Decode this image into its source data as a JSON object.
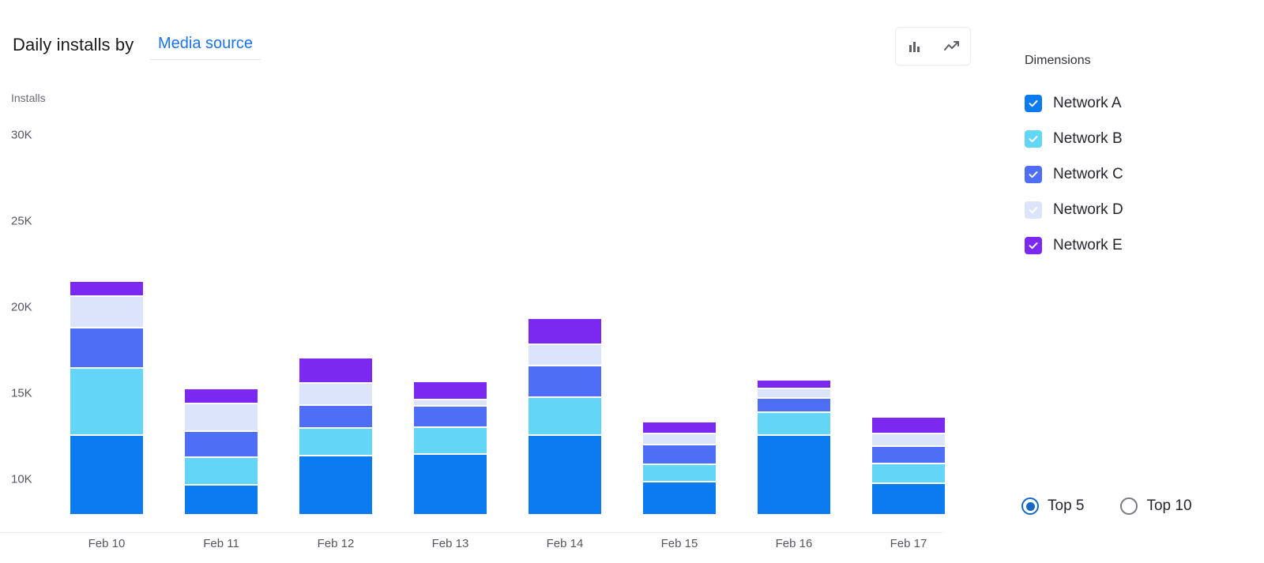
{
  "header": {
    "title": "Daily installs by",
    "dimension_selector": "Media source"
  },
  "toolbar": {
    "bar_chart_icon": "bar-chart-icon",
    "line_chart_icon": "line-chart-icon",
    "selected": "bar"
  },
  "side_panel": {
    "heading": "Dimensions",
    "items": [
      {
        "label": "Network A",
        "color": "#0c7bf0",
        "checked": true
      },
      {
        "label": "Network B",
        "color": "#63d6f7",
        "checked": true
      },
      {
        "label": "Network C",
        "color": "#4d6ef5",
        "checked": true
      },
      {
        "label": "Network D",
        "color": "#dbe4fb",
        "checked": true
      },
      {
        "label": "Network E",
        "color": "#7b28f0",
        "checked": true
      }
    ],
    "top_n": {
      "options": [
        {
          "label": "Top 5",
          "selected": true
        },
        {
          "label": "Top 10",
          "selected": false
        }
      ]
    }
  },
  "chart_data": {
    "type": "bar",
    "stacked": true,
    "title": "Daily installs by Media source",
    "xlabel": "",
    "ylabel": "Installs",
    "ylim": [
      8600,
      31000
    ],
    "yticks": [
      30000,
      25000,
      20000,
      15000,
      10000
    ],
    "ytick_labels": [
      "30K",
      "25K",
      "20K",
      "15K",
      "10K"
    ],
    "grid": false,
    "legend_position": "right",
    "note": "Y axis is truncated; bars are clipped at the bottom of the plot area.",
    "categories": [
      "Feb 10",
      "Feb 11",
      "Feb 12",
      "Feb 13",
      "Feb 14",
      "Feb 15",
      "Feb 16",
      "Feb 17"
    ],
    "series": [
      {
        "name": "Network A",
        "color": "#0c7bf0",
        "values": [
          12900,
          10000,
          11700,
          11800,
          12900,
          10200,
          12900,
          10100
        ]
      },
      {
        "name": "Network B",
        "color": "#63d6f7",
        "values": [
          3800,
          1500,
          1500,
          1450,
          2100,
          900,
          1250,
          1050
        ]
      },
      {
        "name": "Network C",
        "color": "#4d6ef5",
        "values": [
          2250,
          1450,
          1250,
          1150,
          1750,
          1050,
          700,
          900
        ]
      },
      {
        "name": "Network D",
        "color": "#dbe4fb",
        "values": [
          1750,
          1500,
          1200,
          300,
          1150,
          550,
          450,
          650
        ]
      },
      {
        "name": "Network E",
        "color": "#7b28f0",
        "values": [
          750,
          800,
          1350,
          950,
          1400,
          600,
          450,
          900
        ]
      }
    ],
    "totals": [
      21450,
      15250,
      17000,
      15650,
      19300,
      13300,
      15750,
      13600
    ]
  }
}
